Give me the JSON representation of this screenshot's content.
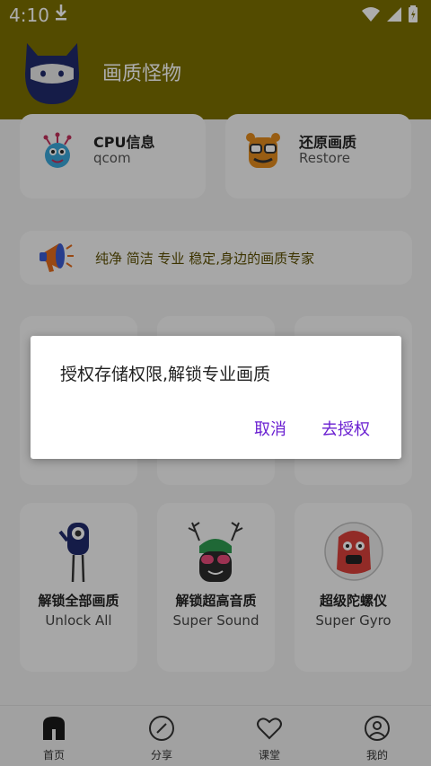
{
  "status_bar": {
    "time": "4:10"
  },
  "app_bar": {
    "title": "画质怪物"
  },
  "top_cards": [
    {
      "title": "CPU信息",
      "subtitle": "qcom"
    },
    {
      "title": "还原画质",
      "subtitle": "Restore"
    }
  ],
  "banner": {
    "text": "纯净 简洁 专业 稳定,身边的画质专家"
  },
  "feature_cards": [
    {
      "title": "解锁全部画质",
      "subtitle": "Unlock All"
    },
    {
      "title": "解锁超高音质",
      "subtitle": "Super Sound"
    },
    {
      "title": "超级陀螺仪",
      "subtitle": "Super Gyro"
    }
  ],
  "dialog": {
    "message": "授权存储权限,解锁专业画质",
    "cancel_label": "取消",
    "confirm_label": "去授权"
  },
  "tabs": [
    {
      "label": "首页",
      "icon": "home-icon"
    },
    {
      "label": "分享",
      "icon": "compass-icon"
    },
    {
      "label": "课堂",
      "icon": "heart-icon"
    },
    {
      "label": "我的",
      "icon": "user-icon"
    }
  ],
  "colors": {
    "header": "#7b6f00",
    "dialog_button": "#6a1fd1",
    "background": "#ededed"
  }
}
